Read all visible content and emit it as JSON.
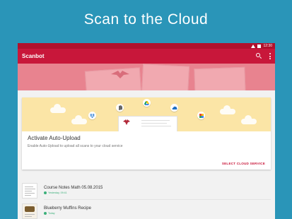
{
  "headline": "Scan to the Cloud",
  "statusbar": {
    "time": "12:30"
  },
  "appbar": {
    "title": "Scanbot"
  },
  "card": {
    "title": "Activate Auto-Upload",
    "description": "Enable Auto-Upload to upload all scans to your cloud service",
    "action_label": "SELECT CLOUD SERVICE",
    "services": [
      "dropbox-icon",
      "evernote-icon",
      "google-drive-icon",
      "onedrive-icon",
      "box-icon",
      "app-icon"
    ]
  },
  "documents": [
    {
      "title": "Course Notes Math 05.08.2015",
      "status": "Yesterday, 09:41"
    },
    {
      "title": "Blueberry Muffins Recipe",
      "status": "Today"
    }
  ],
  "colors": {
    "background": "#2a95b8",
    "appbar": "#c8173a",
    "statusbar": "#b0112c",
    "accent": "#c8173a",
    "card_illustration": "#fbe5a6"
  }
}
